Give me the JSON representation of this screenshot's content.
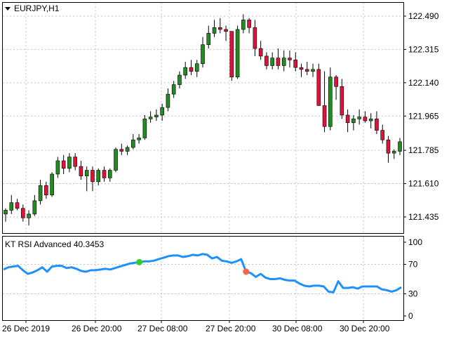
{
  "window": {
    "symbol_label": "EURJPY,H1",
    "collapse_icon": "triangle-down-icon"
  },
  "indicator": {
    "label": "KT RSI Advanced 40.3453",
    "line_color": "#1e90ff",
    "buy_signal_color": "#32cd32",
    "sell_signal_color": "#ff6347"
  },
  "colors": {
    "bull_candle": "#228b22",
    "bear_candle": "#dc143c",
    "wick": "#000000",
    "grid": "#c0c0c0",
    "frame": "#000000"
  },
  "chart_data": [
    {
      "type": "candlestick",
      "title": "EURJPY,H1",
      "ylim": [
        121.35,
        122.56
      ],
      "yticks": [
        "122.490",
        "122.315",
        "122.140",
        "121.965",
        "121.785",
        "121.610",
        "121.435"
      ],
      "xticks": [
        "26 Dec 2019",
        "26 Dec 20:00",
        "27 Dec 08:00",
        "27 Dec 20:00",
        "30 Dec 08:00",
        "30 Dec 20:00"
      ],
      "grid": true,
      "candles": [
        [
          121.45,
          121.48,
          121.41,
          121.47
        ],
        [
          121.47,
          121.55,
          121.45,
          121.51
        ],
        [
          121.51,
          121.53,
          121.47,
          121.48
        ],
        [
          121.48,
          121.5,
          121.41,
          121.43
        ],
        [
          121.43,
          121.47,
          121.39,
          121.45
        ],
        [
          121.45,
          121.55,
          121.44,
          121.52
        ],
        [
          121.52,
          121.63,
          121.5,
          121.6
        ],
        [
          121.6,
          121.62,
          121.53,
          121.55
        ],
        [
          121.55,
          121.67,
          121.54,
          121.66
        ],
        [
          121.66,
          121.75,
          121.64,
          121.73
        ],
        [
          121.73,
          121.76,
          121.66,
          121.69
        ],
        [
          121.69,
          121.77,
          121.67,
          121.75
        ],
        [
          121.75,
          121.77,
          121.68,
          121.7
        ],
        [
          121.7,
          121.73,
          121.63,
          121.65
        ],
        [
          121.65,
          121.7,
          121.57,
          121.68
        ],
        [
          121.68,
          121.7,
          121.57,
          121.62
        ],
        [
          121.62,
          121.69,
          121.6,
          121.68
        ],
        [
          121.68,
          121.7,
          121.62,
          121.64
        ],
        [
          121.64,
          121.69,
          121.62,
          121.68
        ],
        [
          121.68,
          121.8,
          121.67,
          121.79
        ],
        [
          121.79,
          121.82,
          121.76,
          121.78
        ],
        [
          121.78,
          121.81,
          121.76,
          121.8
        ],
        [
          121.8,
          121.87,
          121.79,
          121.84
        ],
        [
          121.84,
          121.87,
          121.82,
          121.85
        ],
        [
          121.85,
          121.97,
          121.84,
          121.95
        ],
        [
          121.95,
          121.99,
          121.93,
          121.96
        ],
        [
          121.96,
          122.0,
          121.94,
          121.97
        ],
        [
          121.97,
          122.03,
          121.94,
          122.01
        ],
        [
          122.01,
          122.11,
          121.99,
          122.08
        ],
        [
          122.08,
          122.15,
          122.06,
          122.13
        ],
        [
          122.13,
          122.2,
          122.11,
          122.18
        ],
        [
          122.18,
          122.25,
          122.16,
          122.22
        ],
        [
          122.22,
          122.26,
          122.18,
          122.2
        ],
        [
          122.2,
          122.26,
          122.17,
          122.24
        ],
        [
          122.24,
          122.38,
          122.22,
          122.34
        ],
        [
          122.34,
          122.44,
          122.32,
          122.4
        ],
        [
          122.4,
          122.47,
          122.38,
          122.43
        ],
        [
          122.43,
          122.48,
          122.4,
          122.42
        ],
        [
          122.42,
          122.44,
          122.36,
          122.41
        ],
        [
          122.41,
          122.34,
          122.15,
          122.17
        ],
        [
          122.17,
          122.44,
          122.16,
          122.42
        ],
        [
          122.42,
          122.5,
          122.4,
          122.47
        ],
        [
          122.47,
          122.48,
          122.4,
          122.43
        ],
        [
          122.43,
          122.47,
          122.28,
          122.32
        ],
        [
          122.32,
          122.36,
          122.26,
          122.28
        ],
        [
          122.28,
          122.3,
          122.21,
          122.23
        ],
        [
          122.23,
          122.3,
          122.21,
          122.27
        ],
        [
          122.27,
          122.32,
          122.21,
          122.23
        ],
        [
          122.23,
          122.31,
          122.2,
          122.27
        ],
        [
          122.27,
          122.31,
          122.22,
          122.26
        ],
        [
          122.26,
          122.3,
          122.2,
          122.22
        ],
        [
          122.22,
          122.24,
          122.17,
          122.21
        ],
        [
          122.21,
          122.25,
          122.18,
          122.2
        ],
        [
          122.2,
          122.24,
          122.17,
          122.21
        ],
        [
          122.21,
          122.24,
          122.15,
          122.02
        ],
        [
          122.02,
          122.2,
          121.88,
          121.91
        ],
        [
          121.91,
          122.22,
          121.89,
          122.17
        ],
        [
          122.17,
          122.18,
          122.05,
          122.12
        ],
        [
          122.12,
          122.16,
          121.95,
          121.97
        ],
        [
          121.97,
          122.0,
          121.88,
          121.93
        ],
        [
          121.93,
          121.97,
          121.89,
          121.95
        ],
        [
          121.95,
          122.0,
          121.92,
          121.96
        ],
        [
          121.96,
          121.99,
          121.93,
          121.94
        ],
        [
          121.94,
          121.98,
          121.9,
          121.95
        ],
        [
          121.95,
          121.99,
          121.87,
          121.89
        ],
        [
          121.89,
          121.92,
          121.82,
          121.84
        ],
        [
          121.84,
          121.86,
          121.72,
          121.77
        ],
        [
          121.77,
          121.79,
          121.74,
          121.78
        ],
        [
          121.78,
          121.85,
          121.76,
          121.83
        ]
      ]
    },
    {
      "type": "line",
      "title": "KT RSI Advanced 40.3453",
      "ylim": [
        0,
        100
      ],
      "yticks": [
        "100",
        "70",
        "30",
        "0"
      ],
      "series": [
        {
          "values": [
            63,
            66,
            67,
            68,
            62,
            57,
            59,
            62,
            66,
            60,
            67,
            68,
            68,
            65,
            66,
            64,
            61,
            60,
            62,
            62,
            63,
            64,
            63,
            65,
            67,
            69,
            71,
            72,
            73,
            74,
            74,
            75,
            77,
            79,
            81,
            82,
            82,
            80,
            81,
            83,
            82,
            84,
            83,
            78,
            80,
            75,
            74,
            72,
            74,
            77,
            60,
            58,
            53,
            57,
            52,
            50,
            50,
            51,
            49,
            48,
            48,
            44,
            41,
            40,
            41,
            41,
            40,
            33,
            32,
            47,
            38,
            38,
            39,
            37,
            40,
            40,
            40,
            40,
            36,
            35,
            33,
            35,
            39
          ],
          "markers": [
            {
              "index": 28,
              "type": "buy",
              "value": 73
            },
            {
              "index": 50,
              "type": "sell",
              "value": 60
            }
          ]
        }
      ]
    }
  ]
}
